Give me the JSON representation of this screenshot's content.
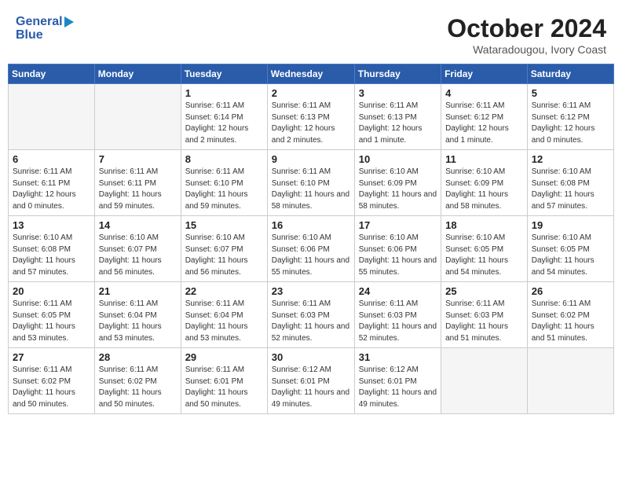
{
  "header": {
    "logo_line1": "General",
    "logo_line2": "Blue",
    "title": "October 2024",
    "subtitle": "Wataradougou, Ivory Coast"
  },
  "days_of_week": [
    "Sunday",
    "Monday",
    "Tuesday",
    "Wednesday",
    "Thursday",
    "Friday",
    "Saturday"
  ],
  "weeks": [
    [
      {
        "day": "",
        "info": ""
      },
      {
        "day": "",
        "info": ""
      },
      {
        "day": "1",
        "info": "Sunrise: 6:11 AM\nSunset: 6:14 PM\nDaylight: 12 hours and 2 minutes."
      },
      {
        "day": "2",
        "info": "Sunrise: 6:11 AM\nSunset: 6:13 PM\nDaylight: 12 hours and 2 minutes."
      },
      {
        "day": "3",
        "info": "Sunrise: 6:11 AM\nSunset: 6:13 PM\nDaylight: 12 hours and 1 minute."
      },
      {
        "day": "4",
        "info": "Sunrise: 6:11 AM\nSunset: 6:12 PM\nDaylight: 12 hours and 1 minute."
      },
      {
        "day": "5",
        "info": "Sunrise: 6:11 AM\nSunset: 6:12 PM\nDaylight: 12 hours and 0 minutes."
      }
    ],
    [
      {
        "day": "6",
        "info": "Sunrise: 6:11 AM\nSunset: 6:11 PM\nDaylight: 12 hours and 0 minutes."
      },
      {
        "day": "7",
        "info": "Sunrise: 6:11 AM\nSunset: 6:11 PM\nDaylight: 11 hours and 59 minutes."
      },
      {
        "day": "8",
        "info": "Sunrise: 6:11 AM\nSunset: 6:10 PM\nDaylight: 11 hours and 59 minutes."
      },
      {
        "day": "9",
        "info": "Sunrise: 6:11 AM\nSunset: 6:10 PM\nDaylight: 11 hours and 58 minutes."
      },
      {
        "day": "10",
        "info": "Sunrise: 6:10 AM\nSunset: 6:09 PM\nDaylight: 11 hours and 58 minutes."
      },
      {
        "day": "11",
        "info": "Sunrise: 6:10 AM\nSunset: 6:09 PM\nDaylight: 11 hours and 58 minutes."
      },
      {
        "day": "12",
        "info": "Sunrise: 6:10 AM\nSunset: 6:08 PM\nDaylight: 11 hours and 57 minutes."
      }
    ],
    [
      {
        "day": "13",
        "info": "Sunrise: 6:10 AM\nSunset: 6:08 PM\nDaylight: 11 hours and 57 minutes."
      },
      {
        "day": "14",
        "info": "Sunrise: 6:10 AM\nSunset: 6:07 PM\nDaylight: 11 hours and 56 minutes."
      },
      {
        "day": "15",
        "info": "Sunrise: 6:10 AM\nSunset: 6:07 PM\nDaylight: 11 hours and 56 minutes."
      },
      {
        "day": "16",
        "info": "Sunrise: 6:10 AM\nSunset: 6:06 PM\nDaylight: 11 hours and 55 minutes."
      },
      {
        "day": "17",
        "info": "Sunrise: 6:10 AM\nSunset: 6:06 PM\nDaylight: 11 hours and 55 minutes."
      },
      {
        "day": "18",
        "info": "Sunrise: 6:10 AM\nSunset: 6:05 PM\nDaylight: 11 hours and 54 minutes."
      },
      {
        "day": "19",
        "info": "Sunrise: 6:10 AM\nSunset: 6:05 PM\nDaylight: 11 hours and 54 minutes."
      }
    ],
    [
      {
        "day": "20",
        "info": "Sunrise: 6:11 AM\nSunset: 6:05 PM\nDaylight: 11 hours and 53 minutes."
      },
      {
        "day": "21",
        "info": "Sunrise: 6:11 AM\nSunset: 6:04 PM\nDaylight: 11 hours and 53 minutes."
      },
      {
        "day": "22",
        "info": "Sunrise: 6:11 AM\nSunset: 6:04 PM\nDaylight: 11 hours and 53 minutes."
      },
      {
        "day": "23",
        "info": "Sunrise: 6:11 AM\nSunset: 6:03 PM\nDaylight: 11 hours and 52 minutes."
      },
      {
        "day": "24",
        "info": "Sunrise: 6:11 AM\nSunset: 6:03 PM\nDaylight: 11 hours and 52 minutes."
      },
      {
        "day": "25",
        "info": "Sunrise: 6:11 AM\nSunset: 6:03 PM\nDaylight: 11 hours and 51 minutes."
      },
      {
        "day": "26",
        "info": "Sunrise: 6:11 AM\nSunset: 6:02 PM\nDaylight: 11 hours and 51 minutes."
      }
    ],
    [
      {
        "day": "27",
        "info": "Sunrise: 6:11 AM\nSunset: 6:02 PM\nDaylight: 11 hours and 50 minutes."
      },
      {
        "day": "28",
        "info": "Sunrise: 6:11 AM\nSunset: 6:02 PM\nDaylight: 11 hours and 50 minutes."
      },
      {
        "day": "29",
        "info": "Sunrise: 6:11 AM\nSunset: 6:01 PM\nDaylight: 11 hours and 50 minutes."
      },
      {
        "day": "30",
        "info": "Sunrise: 6:12 AM\nSunset: 6:01 PM\nDaylight: 11 hours and 49 minutes."
      },
      {
        "day": "31",
        "info": "Sunrise: 6:12 AM\nSunset: 6:01 PM\nDaylight: 11 hours and 49 minutes."
      },
      {
        "day": "",
        "info": ""
      },
      {
        "day": "",
        "info": ""
      }
    ]
  ]
}
